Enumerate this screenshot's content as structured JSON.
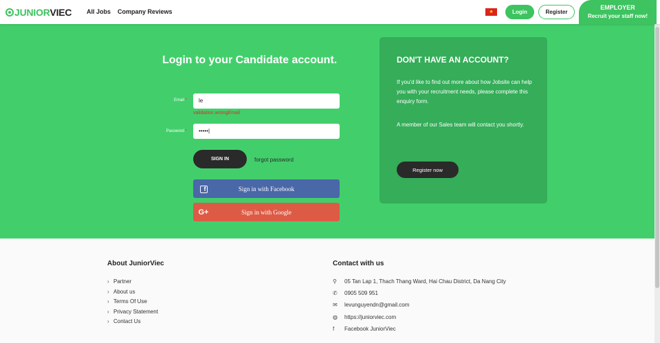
{
  "header": {
    "logo_a": "JUNIOR",
    "logo_b": "VIEC",
    "nav": [
      "All Jobs",
      "Company Reviews"
    ],
    "flag_glyph": "★",
    "login_label": "Login",
    "register_label": "Register",
    "employer_title": "EMPLOYER",
    "employer_sub": "Recruit your staff now!"
  },
  "login": {
    "title": "Login to your Candidate account.",
    "email_label": "Email",
    "email_value": "le",
    "email_error": "validation.wrongEmail",
    "password_label": "Password",
    "password_value": "•••••|",
    "required_mark": "*",
    "signin_label": "SIGN IN",
    "forgot_label": "forgot password",
    "facebook_label": "Sign in with Facebook",
    "facebook_icon": "f",
    "google_label": "Sign in with Google",
    "google_icon": "G+"
  },
  "signup_panel": {
    "title": "DON'T HAVE AN ACCOUNT?",
    "text1": "If you'd like to find out more about how Jobsite can help you with your recruitment needs, please complete this enquiry form.",
    "text2": "A member of our Sales team will contact you shortly.",
    "button_label": "Register now"
  },
  "footer": {
    "about_title": "About JuniorViec",
    "about_links": [
      "Partner",
      "About us",
      "Terms Of Use",
      "Privacy Statement",
      "Contact Us"
    ],
    "chevron": "›",
    "contact_title": "Contact with us",
    "contacts": [
      {
        "icon": "map-marker-icon",
        "glyph": "⚲",
        "text": "05 Tan Lap 1, Thach Thang Ward, Hai Chau District, Da Nang City"
      },
      {
        "icon": "phone-icon",
        "glyph": "✆",
        "text": "0905 509 951"
      },
      {
        "icon": "envelope-icon",
        "glyph": "✉",
        "text": "levunguyendn@gmail.com"
      },
      {
        "icon": "globe-icon",
        "glyph": "◍",
        "text": "https://juniorviec.com"
      },
      {
        "icon": "facebook-icon",
        "glyph": "f",
        "text": "Facebook JuniorViec"
      }
    ]
  },
  "colors": {
    "brand_green": "#3dc35f",
    "hero_green": "#42cf6b",
    "panel_green": "#35ad59",
    "facebook_blue": "#4a67a8",
    "google_red": "#dd5b45"
  }
}
